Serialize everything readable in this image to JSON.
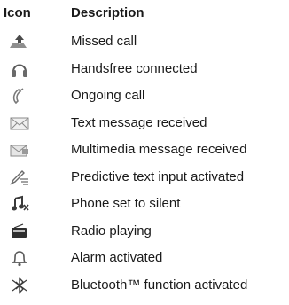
{
  "header": {
    "icon": "Icon",
    "description": "Description"
  },
  "rows": [
    {
      "icon": "missed-call-icon",
      "description": "Missed call"
    },
    {
      "icon": "headphones-icon",
      "description": "Handsfree connected"
    },
    {
      "icon": "phone-handset-icon",
      "description": "Ongoing call"
    },
    {
      "icon": "envelope-icon",
      "description": "Text message received"
    },
    {
      "icon": "mms-envelope-icon",
      "description": "Multimedia message received"
    },
    {
      "icon": "pen-icon",
      "description": "Predictive text input activated"
    },
    {
      "icon": "silent-note-icon",
      "description": "Phone set to silent"
    },
    {
      "icon": "radio-icon",
      "description": "Radio playing"
    },
    {
      "icon": "bell-icon",
      "description": "Alarm activated"
    },
    {
      "icon": "bluetooth-icon",
      "description": "Bluetooth™ function activated"
    }
  ]
}
